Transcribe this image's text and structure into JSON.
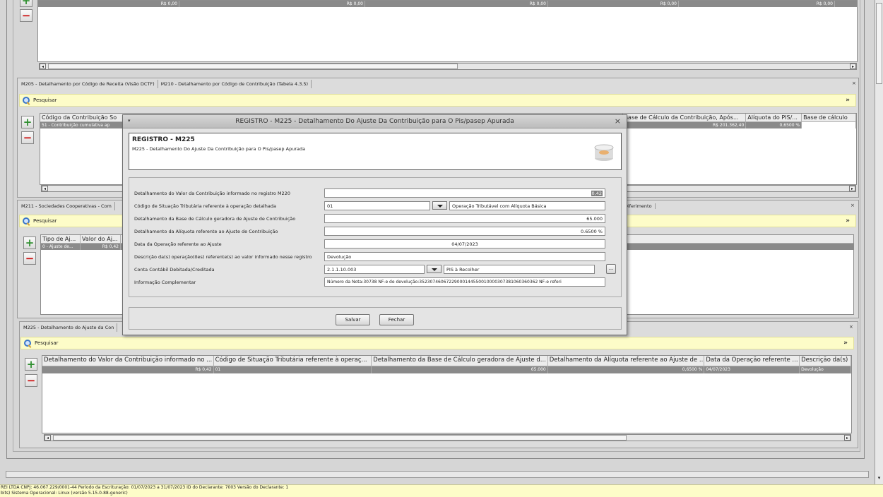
{
  "top_section": {
    "values": [
      "R$ 0,00",
      "R$ 0,00",
      "R$ 0,00",
      "R$ 0,00",
      "R$ 0,00"
    ]
  },
  "m205_section": {
    "tabs": [
      "M205 - Detalhamento por Código de Receita (Visão DCTF)",
      "M210 - Detalhamento por Código de Contribuição (Tabela 4.3.5)"
    ],
    "search_label": "Pesquisar",
    "columns": [
      "Código da Contribuição So",
      "Base de Cálculo da Contribuição, Após...",
      "Alíquota do PIS/...",
      "Base de cálculo"
    ],
    "row": [
      "51 - Contribuição cumulativa ap",
      "R$ 201.362,40",
      "0,6500 %",
      ""
    ]
  },
  "m211_section": {
    "tab_label": "M211 - Sociedades Cooperativas - Com",
    "tab_label_right": "Diferimento",
    "search_label": "Pesquisar",
    "columns": [
      "Tipo de Aj...",
      "Valor do Aj..."
    ],
    "row": [
      "0 - Ajuste de...",
      "R$ 0,42"
    ]
  },
  "m225_section": {
    "tab_label": "M225 - Detalhamento do Ajuste da Con",
    "search_label": "Pesquisar",
    "columns": [
      "Detalhamento do Valor da Contribuição informado no ...",
      "Código de Situação Tributária referente à operaç...",
      "Detalhamento da Base de Cálculo geradora de Ajuste d...",
      "Detalhamento da Alíquota referente ao Ajuste de ...",
      "Data da Operação referente ...",
      "Descrição da(s)"
    ],
    "row": [
      "R$ 0,42",
      "01",
      "65.000",
      "0,6500 %",
      "04/07/2023",
      "Devolução"
    ]
  },
  "modal": {
    "title": "REGISTRO - M225 - Detalhamento Do Ajuste Da Contribuição para O Pis/pasep Apurada",
    "header_title": "REGISTRO - M225",
    "header_subtitle": "M225 - Detalhamento Do Ajuste Da Contribuição para O Pis/pasep Apurada",
    "fields": {
      "valor_label": "Detalhamento do Valor da Contribuição informado no registro M220",
      "valor_value": "0,42",
      "cst_label": "Código de Situação Tributária referente à operação detalhada",
      "cst_code": "01",
      "cst_desc": "Operação Tributável com Alíquota Básica",
      "base_label": "Detalhamento da Base de Cálculo geradora de Ajuste de Contribuição",
      "base_value": "65.000",
      "aliquota_label": "Detalhamento da Alíquota referente ao Ajuste de Contribuição",
      "aliquota_value": "0.6500 %",
      "data_label": "Data da Operação referente ao Ajuste",
      "data_value": "04/07/2023",
      "descricao_label": "Descrição da(s) operação(ões) referente(s) ao valor informado nesse registro",
      "descricao_value": "Devolução",
      "conta_label": "Conta Contábil Debitada/Creditada",
      "conta_code": "2.1.1.10.003",
      "conta_desc": "PIS à Recolher",
      "conta_btn": "...",
      "info_label": "Informação Complementar",
      "info_value": "Número da Nota:30738 NF-e de devolução:35230746067229000144550010000307381060360362 NF-e referi"
    },
    "save_label": "Salvar",
    "close_label": "Fechar"
  },
  "status_bar": {
    "line1": "REI LTDA CNPJ: 46.067.229/0001-44 Período da Escrituração: 01/07/2023 a 31/07/2023 ID do Declarante: 7003 Versão do Declarante: 1",
    "line2": "bits) Sistema Operacional: Linux (versão 5.15.0-88-generic)"
  }
}
